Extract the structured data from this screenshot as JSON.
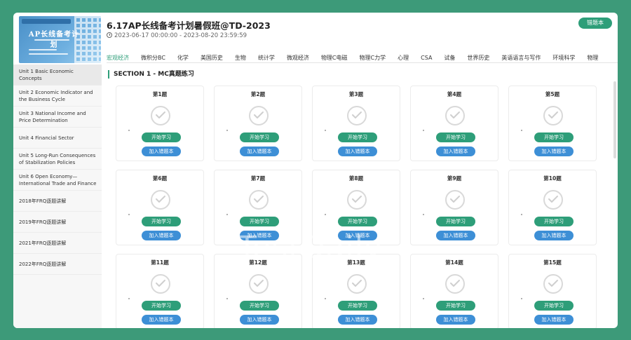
{
  "course": {
    "title": "6.17AP长线备考计划暑假班@TD-2023",
    "date_range": "2023-06-17 00:00:00 - 2023-08-20 23:59:59",
    "cover_title": "AP长线备考计划",
    "wrongbook_label": "错题本"
  },
  "tabs": [
    "宏观经济",
    "微积分BC",
    "化学",
    "美国历史",
    "生物",
    "统计学",
    "微观经济",
    "物理C电磁",
    "物理C力学",
    "心理",
    "CSA",
    "试备",
    "世界历史",
    "英语语言与写作",
    "环境科学",
    "物理"
  ],
  "active_tab": 0,
  "sidebar": {
    "items": [
      "Unit 1 Basic Economic Concepts",
      "Unit 2 Economic Indicator and the Business Cycle",
      "Unit 3 National Income and Price Determination",
      "Unit 4 Financial Sector",
      "Unit 5 Long-Run Consequences of Stabilization Policies",
      "Unit 6 Open Economy—International Trade and Finance",
      "2018年FRQ逐题讲解",
      "2019年FRQ逐题讲解",
      "2021年FRQ逐题讲解",
      "2022年FRQ逐题讲解"
    ],
    "active_index": 0
  },
  "section": {
    "title": "SECTION 1 - MC真题练习"
  },
  "questions": [
    "第1题",
    "第2题",
    "第3题",
    "第4题",
    "第5题",
    "第6题",
    "第7题",
    "第8题",
    "第9题",
    "第10题",
    "第11题",
    "第12题",
    "第13题",
    "第14题",
    "第15题"
  ],
  "buttons": {
    "start": "开始学习",
    "add_wrong": "加入错题本"
  },
  "watermark": "TestDaily",
  "colors": {
    "accent": "#2e9e79",
    "secondary": "#3d8fd6",
    "background": "#3d9a79"
  }
}
